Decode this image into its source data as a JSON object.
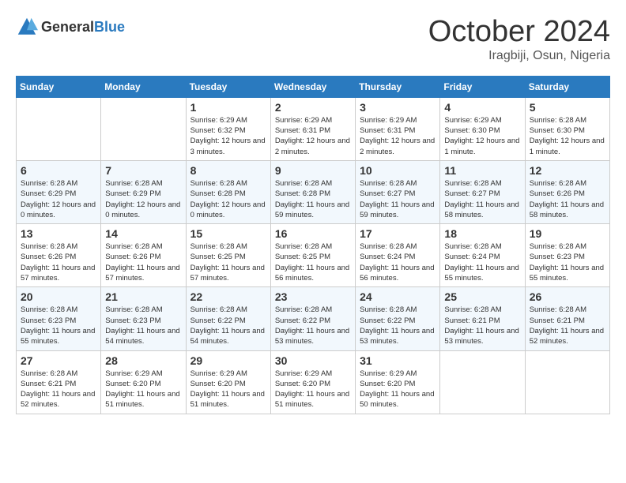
{
  "header": {
    "logo_general": "General",
    "logo_blue": "Blue",
    "month": "October 2024",
    "location": "Iragbiji, Osun, Nigeria"
  },
  "weekdays": [
    "Sunday",
    "Monday",
    "Tuesday",
    "Wednesday",
    "Thursday",
    "Friday",
    "Saturday"
  ],
  "weeks": [
    [
      {
        "day": "",
        "sunrise": "",
        "sunset": "",
        "daylight": ""
      },
      {
        "day": "",
        "sunrise": "",
        "sunset": "",
        "daylight": ""
      },
      {
        "day": "1",
        "sunrise": "Sunrise: 6:29 AM",
        "sunset": "Sunset: 6:32 PM",
        "daylight": "Daylight: 12 hours and 3 minutes."
      },
      {
        "day": "2",
        "sunrise": "Sunrise: 6:29 AM",
        "sunset": "Sunset: 6:31 PM",
        "daylight": "Daylight: 12 hours and 2 minutes."
      },
      {
        "day": "3",
        "sunrise": "Sunrise: 6:29 AM",
        "sunset": "Sunset: 6:31 PM",
        "daylight": "Daylight: 12 hours and 2 minutes."
      },
      {
        "day": "4",
        "sunrise": "Sunrise: 6:29 AM",
        "sunset": "Sunset: 6:30 PM",
        "daylight": "Daylight: 12 hours and 1 minute."
      },
      {
        "day": "5",
        "sunrise": "Sunrise: 6:28 AM",
        "sunset": "Sunset: 6:30 PM",
        "daylight": "Daylight: 12 hours and 1 minute."
      }
    ],
    [
      {
        "day": "6",
        "sunrise": "Sunrise: 6:28 AM",
        "sunset": "Sunset: 6:29 PM",
        "daylight": "Daylight: 12 hours and 0 minutes."
      },
      {
        "day": "7",
        "sunrise": "Sunrise: 6:28 AM",
        "sunset": "Sunset: 6:29 PM",
        "daylight": "Daylight: 12 hours and 0 minutes."
      },
      {
        "day": "8",
        "sunrise": "Sunrise: 6:28 AM",
        "sunset": "Sunset: 6:28 PM",
        "daylight": "Daylight: 12 hours and 0 minutes."
      },
      {
        "day": "9",
        "sunrise": "Sunrise: 6:28 AM",
        "sunset": "Sunset: 6:28 PM",
        "daylight": "Daylight: 11 hours and 59 minutes."
      },
      {
        "day": "10",
        "sunrise": "Sunrise: 6:28 AM",
        "sunset": "Sunset: 6:27 PM",
        "daylight": "Daylight: 11 hours and 59 minutes."
      },
      {
        "day": "11",
        "sunrise": "Sunrise: 6:28 AM",
        "sunset": "Sunset: 6:27 PM",
        "daylight": "Daylight: 11 hours and 58 minutes."
      },
      {
        "day": "12",
        "sunrise": "Sunrise: 6:28 AM",
        "sunset": "Sunset: 6:26 PM",
        "daylight": "Daylight: 11 hours and 58 minutes."
      }
    ],
    [
      {
        "day": "13",
        "sunrise": "Sunrise: 6:28 AM",
        "sunset": "Sunset: 6:26 PM",
        "daylight": "Daylight: 11 hours and 57 minutes."
      },
      {
        "day": "14",
        "sunrise": "Sunrise: 6:28 AM",
        "sunset": "Sunset: 6:26 PM",
        "daylight": "Daylight: 11 hours and 57 minutes."
      },
      {
        "day": "15",
        "sunrise": "Sunrise: 6:28 AM",
        "sunset": "Sunset: 6:25 PM",
        "daylight": "Daylight: 11 hours and 57 minutes."
      },
      {
        "day": "16",
        "sunrise": "Sunrise: 6:28 AM",
        "sunset": "Sunset: 6:25 PM",
        "daylight": "Daylight: 11 hours and 56 minutes."
      },
      {
        "day": "17",
        "sunrise": "Sunrise: 6:28 AM",
        "sunset": "Sunset: 6:24 PM",
        "daylight": "Daylight: 11 hours and 56 minutes."
      },
      {
        "day": "18",
        "sunrise": "Sunrise: 6:28 AM",
        "sunset": "Sunset: 6:24 PM",
        "daylight": "Daylight: 11 hours and 55 minutes."
      },
      {
        "day": "19",
        "sunrise": "Sunrise: 6:28 AM",
        "sunset": "Sunset: 6:23 PM",
        "daylight": "Daylight: 11 hours and 55 minutes."
      }
    ],
    [
      {
        "day": "20",
        "sunrise": "Sunrise: 6:28 AM",
        "sunset": "Sunset: 6:23 PM",
        "daylight": "Daylight: 11 hours and 55 minutes."
      },
      {
        "day": "21",
        "sunrise": "Sunrise: 6:28 AM",
        "sunset": "Sunset: 6:23 PM",
        "daylight": "Daylight: 11 hours and 54 minutes."
      },
      {
        "day": "22",
        "sunrise": "Sunrise: 6:28 AM",
        "sunset": "Sunset: 6:22 PM",
        "daylight": "Daylight: 11 hours and 54 minutes."
      },
      {
        "day": "23",
        "sunrise": "Sunrise: 6:28 AM",
        "sunset": "Sunset: 6:22 PM",
        "daylight": "Daylight: 11 hours and 53 minutes."
      },
      {
        "day": "24",
        "sunrise": "Sunrise: 6:28 AM",
        "sunset": "Sunset: 6:22 PM",
        "daylight": "Daylight: 11 hours and 53 minutes."
      },
      {
        "day": "25",
        "sunrise": "Sunrise: 6:28 AM",
        "sunset": "Sunset: 6:21 PM",
        "daylight": "Daylight: 11 hours and 53 minutes."
      },
      {
        "day": "26",
        "sunrise": "Sunrise: 6:28 AM",
        "sunset": "Sunset: 6:21 PM",
        "daylight": "Daylight: 11 hours and 52 minutes."
      }
    ],
    [
      {
        "day": "27",
        "sunrise": "Sunrise: 6:28 AM",
        "sunset": "Sunset: 6:21 PM",
        "daylight": "Daylight: 11 hours and 52 minutes."
      },
      {
        "day": "28",
        "sunrise": "Sunrise: 6:29 AM",
        "sunset": "Sunset: 6:20 PM",
        "daylight": "Daylight: 11 hours and 51 minutes."
      },
      {
        "day": "29",
        "sunrise": "Sunrise: 6:29 AM",
        "sunset": "Sunset: 6:20 PM",
        "daylight": "Daylight: 11 hours and 51 minutes."
      },
      {
        "day": "30",
        "sunrise": "Sunrise: 6:29 AM",
        "sunset": "Sunset: 6:20 PM",
        "daylight": "Daylight: 11 hours and 51 minutes."
      },
      {
        "day": "31",
        "sunrise": "Sunrise: 6:29 AM",
        "sunset": "Sunset: 6:20 PM",
        "daylight": "Daylight: 11 hours and 50 minutes."
      },
      {
        "day": "",
        "sunrise": "",
        "sunset": "",
        "daylight": ""
      },
      {
        "day": "",
        "sunrise": "",
        "sunset": "",
        "daylight": ""
      }
    ]
  ]
}
